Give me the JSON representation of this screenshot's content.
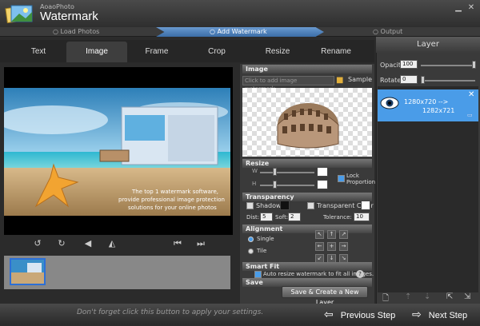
{
  "app": {
    "brand_small": "AoaoPhoto",
    "brand_big": "Watermark"
  },
  "window": {
    "minimize_icon": "minimize-icon",
    "close_icon": "close-icon"
  },
  "steps": [
    "Load Photos",
    "Add Watermark",
    "Output"
  ],
  "tabs": [
    "Text",
    "Image",
    "Frame",
    "Crop",
    "Resize",
    "Rename"
  ],
  "active_tab": "Image",
  "preview": {
    "overlay_text": "The top 1 watermark software, provide professional image protection solutions for your online photos"
  },
  "controls": [
    "rotate-left-icon",
    "rotate-right-icon",
    "flip-horizontal-icon",
    "flip-vertical-icon",
    "previous-image-icon",
    "next-image-icon"
  ],
  "image_section": {
    "title": "Image",
    "placeholder": "Click to add image watermark...",
    "sample_label": "Sample"
  },
  "resize_section": {
    "title": "Resize",
    "w_label": "W",
    "h_label": "H",
    "lock_label": "Lock Proportion"
  },
  "transparency_section": {
    "title": "Transparency",
    "shadow_label": "Shadow",
    "transparent_color_label": "Transparent Color",
    "dist_label": "Dist:",
    "dist_value": "5",
    "soft_label": "Soft:",
    "soft_value": "2",
    "tolerance_label": "Tolerance:",
    "tolerance_value": "10"
  },
  "alignment_section": {
    "title": "Alignment",
    "single_label": "Single",
    "tile_label": "Tile"
  },
  "smartfit_section": {
    "title": "Smart Fit",
    "auto_label": "Auto resize watermark to fit all images."
  },
  "save_section": {
    "title": "Save",
    "button_label": "Save & Create a New Layer"
  },
  "layer": {
    "title": "Layer",
    "opacity_label": "Opacity",
    "opacity_value": "100",
    "rotate_label": "Rotate",
    "rotate_value": "0",
    "item_text_1": "1280x720 -->",
    "item_text_2": "1282x721"
  },
  "bottom": {
    "hint": "Don't forget click this button to apply your settings.",
    "previous_label": "Previous Step",
    "next_label": "Next Step"
  },
  "colors": {
    "accent": "#4a9ce8",
    "step_active": "#4f82bd"
  }
}
